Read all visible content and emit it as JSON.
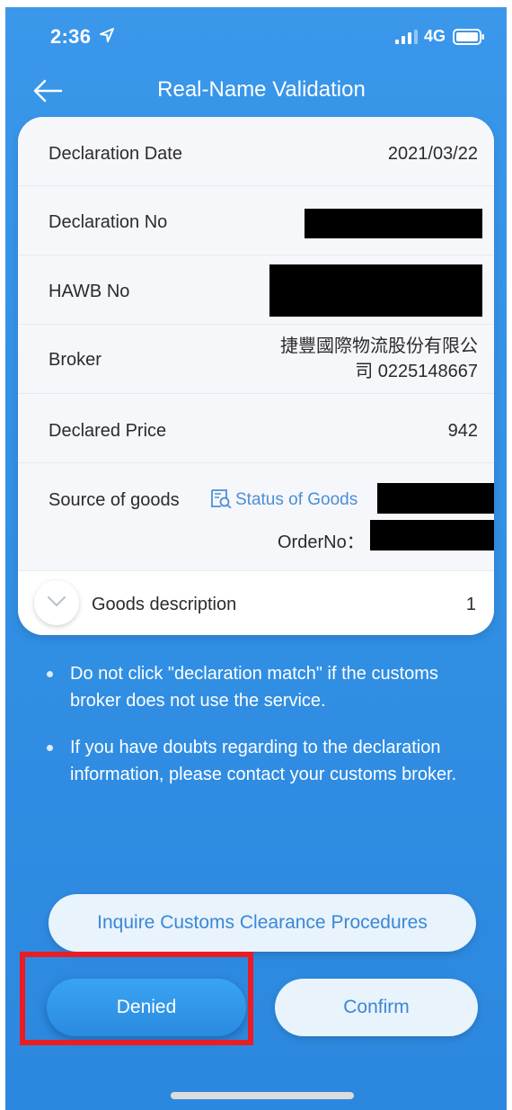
{
  "status_bar": {
    "time": "2:36",
    "network": "4G"
  },
  "nav": {
    "title": "Real-Name Validation"
  },
  "details": {
    "declaration_date_label": "Declaration Date",
    "declaration_date_value": "2021/03/22",
    "declaration_no_label": "Declaration No",
    "hawb_no_label": "HAWB No",
    "broker_label": "Broker",
    "broker_value_line1": "捷豐國際物流股份有限公",
    "broker_value_line2": "司 0225148667",
    "declared_price_label": "Declared Price",
    "declared_price_value": "942",
    "source_label": "Source of goods",
    "status_of_goods_link": "Status of Goods",
    "order_no_label": "OrderNo：",
    "goods_description_label": "Goods description",
    "goods_description_count": "1"
  },
  "notes": [
    "Do not click \"declaration match\" if the customs broker does not use the service.",
    "If you have doubts regarding to the declaration information, please contact your customs broker."
  ],
  "buttons": {
    "inquire": "Inquire Customs Clearance Procedures",
    "denied": "Denied",
    "confirm": "Confirm"
  },
  "colors": {
    "background": "#3290e5",
    "accent": "#3b87d6",
    "highlight": "#ea1c24"
  }
}
